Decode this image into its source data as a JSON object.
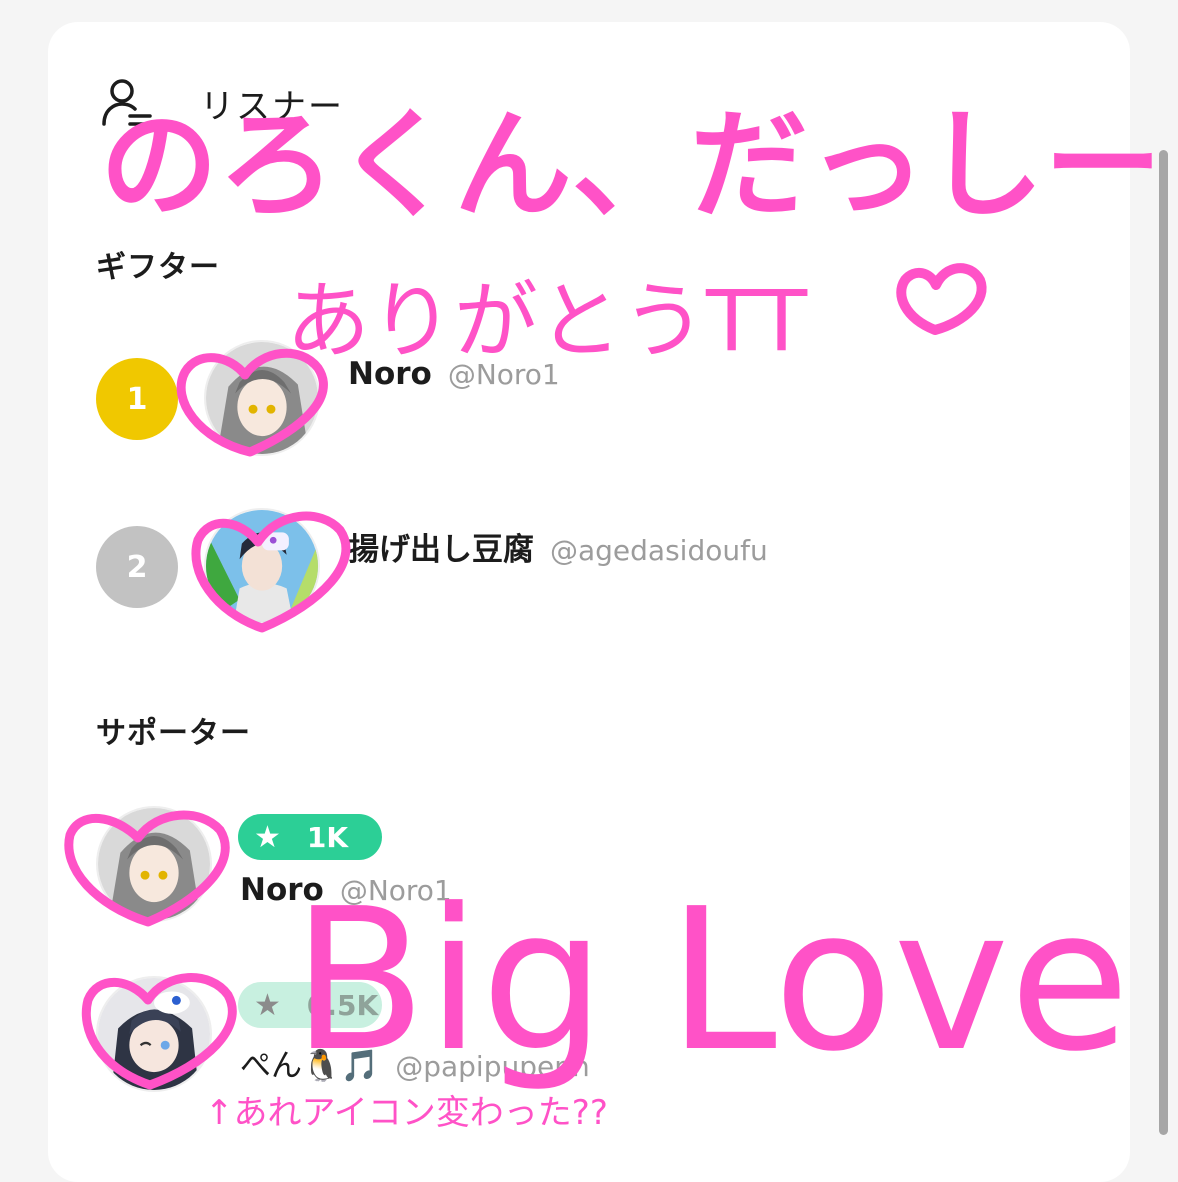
{
  "header": {
    "title": "リスナー",
    "icon": "person-list-icon"
  },
  "sections": {
    "gifters_title": "ギフター",
    "supporters_title": "サポーター"
  },
  "gifters": [
    {
      "rank": "1",
      "rank_color": "#f0c800",
      "name": "Noro",
      "handle": "@Noro1",
      "avatar": "gray-hair-avatar"
    },
    {
      "rank": "2",
      "rank_color": "#c2c2c2",
      "name": "揚げ出し豆腐",
      "handle": "@agedasidoufu",
      "avatar": "masked-avatar"
    }
  ],
  "supporters": [
    {
      "badge": "1K",
      "badge_color": "#2ccf96",
      "name": "Noro",
      "handle": "@Noro1",
      "avatar": "gray-hair-avatar"
    },
    {
      "badge": "0.5K",
      "badge_color": "#c8f0e0",
      "name": "ぺん🐧🎵",
      "handle": "@papipupenn",
      "avatar": "penguin-hat-avatar"
    }
  ],
  "handwriting": {
    "line1": "のろくん、だっしー",
    "line2": "ありがとうTT",
    "big": "Big Love",
    "note": "↑あれアイコン変わった??",
    "ink_color": "#ff52c7"
  }
}
